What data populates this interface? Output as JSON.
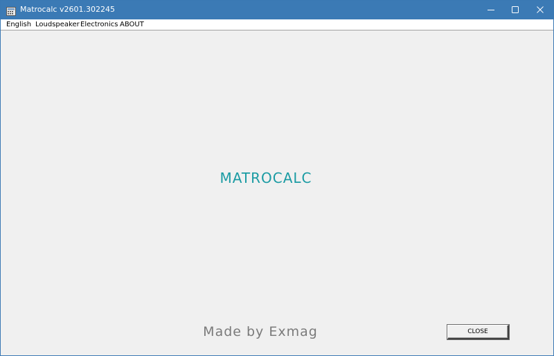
{
  "window": {
    "title": "Matrocalc v2601.302245",
    "controls": {
      "minimize_icon": "minimize-icon",
      "maximize_icon": "maximize-icon",
      "close_icon": "close-icon"
    }
  },
  "menu": {
    "items": [
      {
        "label": "English"
      },
      {
        "label": "Loudspeaker"
      },
      {
        "label": "Electronics"
      },
      {
        "label": "ABOUT"
      }
    ]
  },
  "main": {
    "app_title": "MATROCALC",
    "made_by": "Made by Exmag",
    "close_label": "CLOSE"
  },
  "colors": {
    "titlebar": "#3b7ab5",
    "app_title": "#1a9ba3",
    "made_by": "#7a7a7a",
    "client_bg": "#f0f0f0"
  }
}
